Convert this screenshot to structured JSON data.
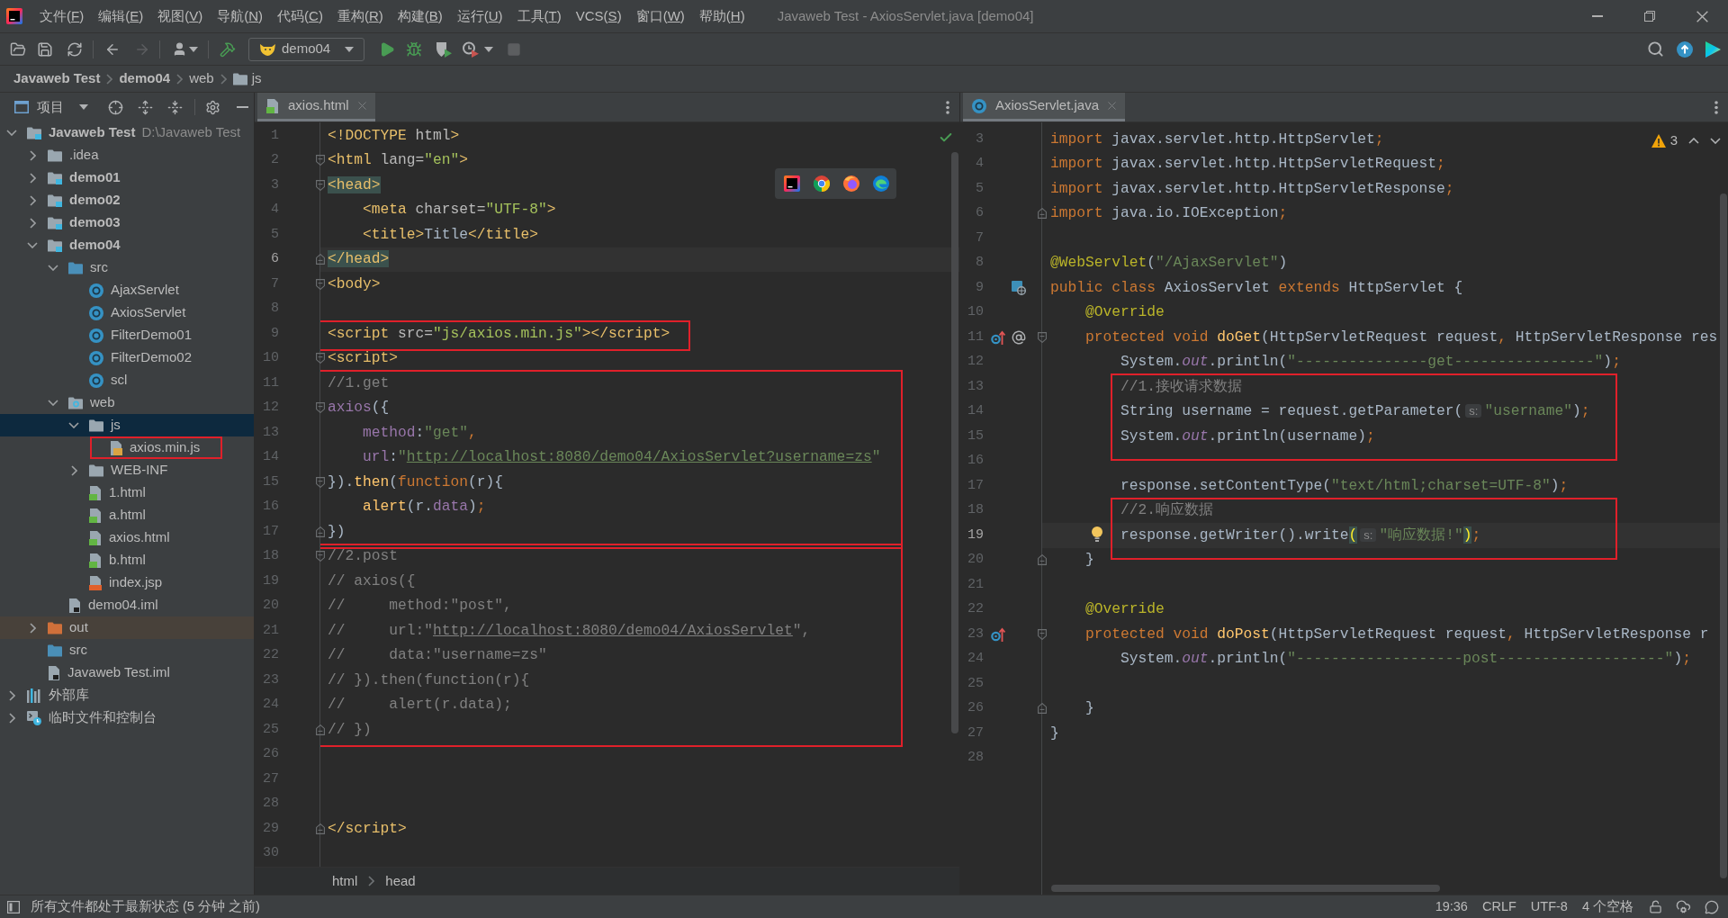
{
  "window": {
    "title": "Javaweb Test - AxiosServlet.java [demo04]"
  },
  "menu": [
    {
      "before": "文件(",
      "key": "F",
      "after": ")"
    },
    {
      "before": "编辑(",
      "key": "E",
      "after": ")"
    },
    {
      "before": "视图(",
      "key": "V",
      "after": ")"
    },
    {
      "before": "导航(",
      "key": "N",
      "after": ")"
    },
    {
      "before": "代码(",
      "key": "C",
      "after": ")"
    },
    {
      "before": "重构(",
      "key": "R",
      "after": ")"
    },
    {
      "before": "构建(",
      "key": "B",
      "after": ")"
    },
    {
      "before": "运行(",
      "key": "U",
      "after": ")"
    },
    {
      "before": "工具(",
      "key": "T",
      "after": ")"
    },
    {
      "before": "VCS(",
      "key": "S",
      "after": ")"
    },
    {
      "before": "窗口(",
      "key": "W",
      "after": ")"
    },
    {
      "before": "帮助(",
      "key": "H",
      "after": ")"
    }
  ],
  "toolbar": {
    "run_config": "demo04",
    "forward": {
      "disabled": true
    },
    "stop": {
      "disabled": true
    }
  },
  "nav_bar": [
    {
      "label": "Javaweb Test",
      "kind": "project"
    },
    {
      "label": "demo04",
      "kind": "module"
    },
    {
      "label": "web",
      "kind": "directory"
    },
    {
      "label": "js",
      "kind": "folder"
    }
  ],
  "project": {
    "title": "项目",
    "tree": [
      {
        "label": "Javaweb Test",
        "kind": "project",
        "hint": "D:\\Javaweb Test",
        "expanded": true,
        "selected": false,
        "boxed": false,
        "children": [
          {
            "label": ".idea",
            "kind": "folder",
            "expanded": false,
            "selected": false,
            "boxed": false
          },
          {
            "label": "demo01",
            "kind": "module",
            "expanded": false,
            "selected": false,
            "boxed": false
          },
          {
            "label": "demo02",
            "kind": "module",
            "expanded": false,
            "selected": false,
            "boxed": false
          },
          {
            "label": "demo03",
            "kind": "module",
            "expanded": false,
            "selected": false,
            "boxed": false
          },
          {
            "label": "demo04",
            "kind": "module",
            "expanded": true,
            "selected": false,
            "boxed": false,
            "children": [
              {
                "label": "src",
                "kind": "source-folder",
                "expanded": true,
                "selected": false,
                "boxed": false,
                "children": [
                  {
                    "label": "AjaxServlet",
                    "kind": "class",
                    "selected": false,
                    "boxed": false
                  },
                  {
                    "label": "AxiosServlet",
                    "kind": "class",
                    "selected": false,
                    "boxed": false
                  },
                  {
                    "label": "FilterDemo01",
                    "kind": "class",
                    "selected": false,
                    "boxed": false
                  },
                  {
                    "label": "FilterDemo02",
                    "kind": "class",
                    "selected": false,
                    "boxed": false
                  },
                  {
                    "label": "scl",
                    "kind": "class",
                    "selected": false,
                    "boxed": false
                  }
                ]
              },
              {
                "label": "web",
                "kind": "web-folder",
                "expanded": true,
                "selected": false,
                "boxed": false,
                "children": [
                  {
                    "label": "js",
                    "kind": "folder",
                    "expanded": true,
                    "selected": true,
                    "boxed": false,
                    "children": [
                      {
                        "label": "axios.min.js",
                        "kind": "js-file",
                        "selected": false,
                        "boxed": true
                      }
                    ]
                  },
                  {
                    "label": "WEB-INF",
                    "kind": "folder",
                    "expanded": false,
                    "selected": false,
                    "boxed": false
                  },
                  {
                    "label": "1.html",
                    "kind": "html-file",
                    "selected": false,
                    "boxed": false
                  },
                  {
                    "label": "a.html",
                    "kind": "html-file",
                    "selected": false,
                    "boxed": false
                  },
                  {
                    "label": "axios.html",
                    "kind": "html-file",
                    "selected": false,
                    "boxed": false
                  },
                  {
                    "label": "b.html",
                    "kind": "html-file",
                    "selected": false,
                    "boxed": false
                  },
                  {
                    "label": "index.jsp",
                    "kind": "jsp-file",
                    "selected": false,
                    "boxed": false
                  }
                ]
              },
              {
                "label": "demo04.iml",
                "kind": "iml-file",
                "selected": false,
                "boxed": false
              }
            ]
          },
          {
            "label": "out",
            "kind": "excluded-folder",
            "expanded": false,
            "selected": false,
            "boxed": false
          },
          {
            "label": "src",
            "kind": "source-folder",
            "selected": false,
            "boxed": false
          },
          {
            "label": "Javaweb Test.iml",
            "kind": "iml-file",
            "selected": false,
            "boxed": false
          }
        ]
      },
      {
        "label": "外部库",
        "kind": "library",
        "expanded": false,
        "selected": false,
        "boxed": false
      },
      {
        "label": "临时文件和控制台",
        "kind": "scratch",
        "expanded": false,
        "selected": false,
        "boxed": false
      }
    ]
  },
  "editors": [
    {
      "tabs": [
        {
          "label": "axios.html",
          "kind": "html-file",
          "selected": true
        }
      ],
      "inspection": {
        "kind": "ok"
      },
      "browser_popup": true,
      "sections": [
        {
          "boxed": false,
          "lines": [
            {
              "n": "1",
              "current": false,
              "tokens": [
                {
                  "kind": "tag",
                  "text": "<!DOCTYPE"
                },
                {
                  "kind": "attr",
                  "text": " html"
                },
                {
                  "kind": "tag",
                  "text": ">"
                }
              ]
            },
            {
              "n": "2",
              "current": false,
              "fold": {
                "kind": "start"
              },
              "tokens": [
                {
                  "kind": "tag",
                  "text": "<html "
                },
                {
                  "kind": "attr",
                  "text": "lang="
                },
                {
                  "kind": "value",
                  "text": "\"en\""
                },
                {
                  "kind": "tag",
                  "text": ">"
                }
              ]
            },
            {
              "n": "3",
              "current": false,
              "fold": {
                "kind": "start"
              },
              "tokens": [
                {
                  "kind": "tag-match",
                  "text": "<head>"
                }
              ]
            },
            {
              "n": "4",
              "current": false,
              "tokens": [
                {
                  "kind": "tag",
                  "text": "    <meta "
                },
                {
                  "kind": "attr",
                  "text": "charset="
                },
                {
                  "kind": "value",
                  "text": "\"UTF-8\""
                },
                {
                  "kind": "tag",
                  "text": ">"
                }
              ]
            },
            {
              "n": "5",
              "current": false,
              "tokens": [
                {
                  "kind": "tag",
                  "text": "    <title>"
                },
                {
                  "kind": "text",
                  "text": "Title"
                },
                {
                  "kind": "tag",
                  "text": "</title>"
                }
              ]
            },
            {
              "n": "6",
              "current": true,
              "fold": {
                "kind": "end"
              },
              "tokens": [
                {
                  "kind": "tag-match",
                  "text": "</head>"
                }
              ]
            },
            {
              "n": "7",
              "current": false,
              "fold": {
                "kind": "start"
              },
              "tokens": [
                {
                  "kind": "tag",
                  "text": "<body>"
                }
              ]
            },
            {
              "n": "8",
              "current": false
            }
          ]
        },
        {
          "boxed": true,
          "lines": [
            {
              "n": "9",
              "current": false,
              "tokens": [
                {
                  "kind": "tag",
                  "text": "<script "
                },
                {
                  "kind": "attr",
                  "text": "src="
                },
                {
                  "kind": "value",
                  "text": "\"js/axios.min.js\""
                },
                {
                  "kind": "tag",
                  "text": "></script>"
                }
              ]
            }
          ]
        },
        {
          "boxed": false,
          "lines": [
            {
              "n": "10",
              "current": false,
              "fold": {
                "kind": "start"
              },
              "tokens": [
                {
                  "kind": "tag",
                  "text": "<script>"
                }
              ]
            }
          ]
        },
        {
          "boxed": true,
          "lines": [
            {
              "n": "11",
              "current": false,
              "tokens": [
                {
                  "kind": "comment",
                  "text": "//1.get"
                }
              ]
            },
            {
              "n": "12",
              "current": false,
              "fold": {
                "kind": "start"
              },
              "tokens": [
                {
                  "kind": "field",
                  "text": "axios"
                },
                {
                  "kind": "text",
                  "text": "({"
                }
              ]
            },
            {
              "n": "13",
              "current": false,
              "tokens": [
                {
                  "kind": "field",
                  "text": "    method"
                },
                {
                  "kind": "text",
                  "text": ":"
                },
                {
                  "kind": "string",
                  "text": "\"get\""
                },
                {
                  "kind": "keyword",
                  "text": ","
                }
              ]
            },
            {
              "n": "14",
              "current": false,
              "tokens": [
                {
                  "kind": "field",
                  "text": "    url"
                },
                {
                  "kind": "text",
                  "text": ":"
                },
                {
                  "kind": "string",
                  "text": "\""
                },
                {
                  "kind": "url",
                  "text": "http://localhost:8080/demo04/AxiosServlet?username=zs"
                },
                {
                  "kind": "string",
                  "text": "\""
                }
              ]
            },
            {
              "n": "15",
              "current": false,
              "fold": {
                "kind": "start"
              },
              "tokens": [
                {
                  "kind": "text",
                  "text": "})."
                },
                {
                  "kind": "function",
                  "text": "then"
                },
                {
                  "kind": "text",
                  "text": "("
                },
                {
                  "kind": "keyword",
                  "text": "function"
                },
                {
                  "kind": "text",
                  "text": "(r){"
                }
              ]
            },
            {
              "n": "16",
              "current": false,
              "tokens": [
                {
                  "kind": "function",
                  "text": "    alert"
                },
                {
                  "kind": "text",
                  "text": "(r."
                },
                {
                  "kind": "field",
                  "text": "data"
                },
                {
                  "kind": "text",
                  "text": ")"
                },
                {
                  "kind": "keyword",
                  "text": ";"
                }
              ]
            },
            {
              "n": "17",
              "current": false,
              "fold": {
                "kind": "end"
              },
              "tokens": [
                {
                  "kind": "text",
                  "text": "})"
                }
              ]
            }
          ]
        },
        {
          "boxed": true,
          "lines": [
            {
              "n": "18",
              "current": false,
              "fold": {
                "kind": "start"
              },
              "tokens": [
                {
                  "kind": "comment",
                  "text": "//2.post"
                }
              ]
            },
            {
              "n": "19",
              "current": false,
              "tokens": [
                {
                  "kind": "comment",
                  "text": "// axios({"
                }
              ]
            },
            {
              "n": "20",
              "current": false,
              "tokens": [
                {
                  "kind": "comment",
                  "text": "//     method:\"post\","
                }
              ]
            },
            {
              "n": "21",
              "current": false,
              "tokens": [
                {
                  "kind": "comment",
                  "text": "//     url:\""
                },
                {
                  "kind": "comment-url",
                  "text": "http://localhost:8080/demo04/AxiosServlet"
                },
                {
                  "kind": "comment",
                  "text": "\","
                }
              ]
            },
            {
              "n": "22",
              "current": false,
              "tokens": [
                {
                  "kind": "comment",
                  "text": "//     data:\"username=zs\""
                }
              ]
            },
            {
              "n": "23",
              "current": false,
              "tokens": [
                {
                  "kind": "comment",
                  "text": "// }).then(function(r){"
                }
              ]
            },
            {
              "n": "24",
              "current": false,
              "tokens": [
                {
                  "kind": "comment",
                  "text": "//     alert(r.data);"
                }
              ]
            },
            {
              "n": "25",
              "current": false,
              "fold": {
                "kind": "end"
              },
              "tokens": [
                {
                  "kind": "comment",
                  "text": "// })"
                }
              ]
            }
          ]
        },
        {
          "boxed": false,
          "lines": [
            {
              "n": "26",
              "current": false
            },
            {
              "n": "27",
              "current": false
            },
            {
              "n": "28",
              "current": false
            },
            {
              "n": "29",
              "current": false,
              "fold": {
                "kind": "end"
              },
              "tokens": [
                {
                  "kind": "tag",
                  "text": "</script>"
                }
              ]
            },
            {
              "n": "30",
              "current": false
            }
          ]
        }
      ],
      "breadcrumbs": [
        "html",
        "head"
      ]
    },
    {
      "tabs": [
        {
          "label": "AxiosServlet.java",
          "kind": "class",
          "selected": true
        }
      ],
      "inspection": {
        "kind": "warning",
        "count": "3"
      },
      "sections": [
        {
          "boxed": false,
          "lines": [
            {
              "n": "3",
              "current": false,
              "tokens": [
                {
                  "kind": "keyword",
                  "text": "import "
                },
                {
                  "kind": "text",
                  "text": "javax.servlet.http.HttpServlet"
                },
                {
                  "kind": "keyword",
                  "text": ";"
                }
              ]
            },
            {
              "n": "4",
              "current": false,
              "tokens": [
                {
                  "kind": "keyword",
                  "text": "import "
                },
                {
                  "kind": "text",
                  "text": "javax.servlet.http.HttpServletRequest"
                },
                {
                  "kind": "keyword",
                  "text": ";"
                }
              ]
            },
            {
              "n": "5",
              "current": false,
              "tokens": [
                {
                  "kind": "keyword",
                  "text": "import "
                },
                {
                  "kind": "text",
                  "text": "javax.servlet.http.HttpServletResponse"
                },
                {
                  "kind": "keyword",
                  "text": ";"
                }
              ]
            },
            {
              "n": "6",
              "current": false,
              "fold": {
                "kind": "end"
              },
              "tokens": [
                {
                  "kind": "keyword",
                  "text": "import "
                },
                {
                  "kind": "text",
                  "text": "java.io.IOException"
                },
                {
                  "kind": "keyword",
                  "text": ";"
                }
              ]
            },
            {
              "n": "7",
              "current": false
            },
            {
              "n": "8",
              "current": false,
              "tokens": [
                {
                  "kind": "annotation",
                  "text": "@WebServlet"
                },
                {
                  "kind": "text",
                  "text": "("
                },
                {
                  "kind": "string",
                  "text": "\"/AjaxServlet\""
                },
                {
                  "kind": "text",
                  "text": ")"
                }
              ]
            },
            {
              "n": "9",
              "current": false,
              "gutter": [
                {
                  "kind": "servlet"
                }
              ],
              "tokens": [
                {
                  "kind": "keyword",
                  "text": "public class "
                },
                {
                  "kind": "text",
                  "text": "AxiosServlet "
                },
                {
                  "kind": "keyword",
                  "text": "extends "
                },
                {
                  "kind": "text",
                  "text": "HttpServlet {"
                }
              ]
            },
            {
              "n": "10",
              "current": false,
              "tokens": [
                {
                  "kind": "annotation",
                  "text": "    @Override"
                }
              ]
            },
            {
              "n": "11",
              "current": false,
              "fold": {
                "kind": "start"
              },
              "gutter": [
                {
                  "kind": "override"
                },
                {
                  "kind": "at"
                }
              ],
              "tokens": [
                {
                  "kind": "keyword",
                  "text": "    protected void "
                },
                {
                  "kind": "function",
                  "text": "doGet"
                },
                {
                  "kind": "text",
                  "text": "(HttpServletRequest request"
                },
                {
                  "kind": "keyword",
                  "text": ", "
                },
                {
                  "kind": "text",
                  "text": "HttpServletResponse res"
                }
              ]
            },
            {
              "n": "12",
              "current": false,
              "tokens": [
                {
                  "kind": "text",
                  "text": "        System."
                },
                {
                  "kind": "static-field",
                  "text": "out"
                },
                {
                  "kind": "text",
                  "text": ".println("
                },
                {
                  "kind": "string",
                  "text": "\"---------------get----------------\""
                },
                {
                  "kind": "text",
                  "text": ")"
                },
                {
                  "kind": "keyword",
                  "text": ";"
                }
              ]
            }
          ]
        },
        {
          "boxed": true,
          "lines": [
            {
              "n": "13",
              "current": false,
              "tokens": [
                {
                  "kind": "comment",
                  "text": "        //1.接收请求数据"
                }
              ]
            },
            {
              "n": "14",
              "current": false,
              "tokens": [
                {
                  "kind": "text",
                  "text": "        String username = request.getParameter("
                },
                {
                  "kind": "hint",
                  "text": "s:"
                },
                {
                  "kind": "string",
                  "text": "\"username\""
                },
                {
                  "kind": "text",
                  "text": ")"
                },
                {
                  "kind": "keyword",
                  "text": ";"
                }
              ]
            },
            {
              "n": "15",
              "current": false,
              "tokens": [
                {
                  "kind": "text",
                  "text": "        System."
                },
                {
                  "kind": "static-field",
                  "text": "out"
                },
                {
                  "kind": "text",
                  "text": ".println(username)"
                },
                {
                  "kind": "keyword",
                  "text": ";"
                }
              ]
            }
          ]
        },
        {
          "boxed": false,
          "lines": [
            {
              "n": "16",
              "current": false
            },
            {
              "n": "17",
              "current": false,
              "tokens": [
                {
                  "kind": "text",
                  "text": "        response.setContentType("
                },
                {
                  "kind": "string",
                  "text": "\"text/html;charset=UTF-8\""
                },
                {
                  "kind": "text",
                  "text": ")"
                },
                {
                  "kind": "keyword",
                  "text": ";"
                }
              ]
            }
          ]
        },
        {
          "boxed": true,
          "lines": [
            {
              "n": "18",
              "current": false,
              "tokens": [
                {
                  "kind": "comment",
                  "text": "        //2.响应数据"
                }
              ]
            },
            {
              "n": "19",
              "current": true,
              "gutter": [
                {
                  "kind": "bulb"
                }
              ],
              "tokens": [
                {
                  "kind": "text",
                  "text": "        response.getWriter().write"
                },
                {
                  "kind": "brace-match",
                  "text": "("
                },
                {
                  "kind": "hint",
                  "text": "s:"
                },
                {
                  "kind": "string",
                  "text": "\"响应数据!\""
                },
                {
                  "kind": "brace-match",
                  "text": ")"
                },
                {
                  "kind": "keyword",
                  "text": ";"
                }
              ]
            }
          ]
        },
        {
          "boxed": false,
          "lines": [
            {
              "n": "20",
              "current": false,
              "fold": {
                "kind": "end"
              },
              "tokens": [
                {
                  "kind": "text",
                  "text": "    }"
                }
              ]
            },
            {
              "n": "21",
              "current": false
            },
            {
              "n": "22",
              "current": false,
              "tokens": [
                {
                  "kind": "annotation",
                  "text": "    @Override"
                }
              ]
            },
            {
              "n": "23",
              "current": false,
              "fold": {
                "kind": "start"
              },
              "gutter": [
                {
                  "kind": "override"
                }
              ],
              "tokens": [
                {
                  "kind": "keyword",
                  "text": "    protected void "
                },
                {
                  "kind": "function",
                  "text": "doPost"
                },
                {
                  "kind": "text",
                  "text": "(HttpServletRequest request"
                },
                {
                  "kind": "keyword",
                  "text": ", "
                },
                {
                  "kind": "text",
                  "text": "HttpServletResponse r"
                }
              ]
            },
            {
              "n": "24",
              "current": false,
              "tokens": [
                {
                  "kind": "text",
                  "text": "        System."
                },
                {
                  "kind": "static-field",
                  "text": "out"
                },
                {
                  "kind": "text",
                  "text": ".println("
                },
                {
                  "kind": "string",
                  "text": "\"-------------------post-------------------\""
                },
                {
                  "kind": "text",
                  "text": ")"
                },
                {
                  "kind": "keyword",
                  "text": ";"
                }
              ]
            },
            {
              "n": "25",
              "current": false
            },
            {
              "n": "26",
              "current": false,
              "fold": {
                "kind": "end"
              },
              "tokens": [
                {
                  "kind": "text",
                  "text": "    }"
                }
              ]
            },
            {
              "n": "27",
              "current": false,
              "tokens": [
                {
                  "kind": "text",
                  "text": "}"
                }
              ]
            },
            {
              "n": "28",
              "current": false
            }
          ]
        }
      ]
    }
  ],
  "status_bar": {
    "message": "所有文件都处于最新状态 (5 分钟 之前)",
    "widgets": [
      "19:36",
      "CRLF",
      "UTF-8",
      "4 个空格"
    ]
  }
}
